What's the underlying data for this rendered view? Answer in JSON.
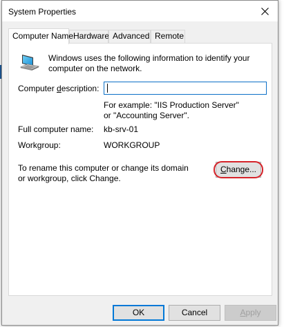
{
  "window": {
    "title": "System Properties"
  },
  "tabs": [
    {
      "label": "Computer Name",
      "active": true
    },
    {
      "label": "Hardware",
      "active": false
    },
    {
      "label": "Advanced",
      "active": false
    },
    {
      "label": "Remote",
      "active": false
    }
  ],
  "computer_name_tab": {
    "intro_text": "Windows uses the following information to identify your computer on the network.",
    "description": {
      "label_pre": "Computer ",
      "label_access": "d",
      "label_post": "escription:",
      "value": "",
      "example_text": "For example: \"IIS Production Server\" or \"Accounting Server\"."
    },
    "full_name": {
      "label": "Full computer name:",
      "value": "kb-srv-01"
    },
    "workgroup": {
      "label": "Workgroup:",
      "value": "WORKGROUP"
    },
    "rename_text": "To rename this computer or change its domain or workgroup, click Change.",
    "change_button": {
      "access": "C",
      "rest": "hange..."
    }
  },
  "footer": {
    "ok_label": "OK",
    "cancel_label": "Cancel",
    "apply_label_access": "A",
    "apply_label_rest": "pply",
    "apply_disabled": true
  },
  "colors": {
    "accent": "#0078d7",
    "highlight_ring": "#d6232a"
  },
  "icons": {
    "computer": "computer-icon",
    "close": "close-icon"
  }
}
